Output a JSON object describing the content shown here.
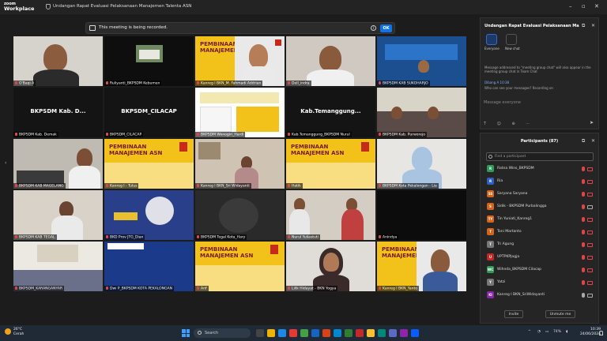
{
  "app": {
    "logo_line1": "zoom",
    "logo_line2": "Workplace",
    "window_title": "Undangan Rapat Evaluasi Pelaksanaan Manajemen Talenta ASN"
  },
  "recording": {
    "text": "This meeting is being recorded.",
    "info": "i",
    "ok_label": "OK"
  },
  "tiles": [
    {
      "label": "O'Baqi A"
    },
    {
      "label": "Ruliyanti_BKPSDM Kebumen"
    },
    {
      "label": "Kanreg I BKN_M. Fahmadi Addrian",
      "slide_title": "PEMBINAAN\nMANAJEMEN ASN"
    },
    {
      "label": "Dell_indra"
    },
    {
      "label": "BKPSDM KAB SUKOHARJO"
    },
    {
      "label": "BKPSDM Kab. Demak",
      "center": "BKPSDM Kab. D..."
    },
    {
      "label": "BKPSDM_CILACAP",
      "center": "BKPSDM_CILACAP"
    },
    {
      "label": "BKPSDM Wonogiri_Hardi"
    },
    {
      "label": "Kab.Temanggung_BKPSDM Nurul",
      "center": "Kab.Temanggung..."
    },
    {
      "label": "BKPSDM Kab. Purworejo"
    },
    {
      "label": "BKPSDM KAB MAGELANG"
    },
    {
      "label": "Kanreg I - Tulus",
      "slide_title": "PEMBINAAN\nMANAJEMEN ASN"
    },
    {
      "label": "Kanreg I BKN_Sri Widayanti"
    },
    {
      "label": "Hatik",
      "slide_title": "PEMBINAAN\nMANAJEMEN ASN"
    },
    {
      "label": "BKPSDM Kota Pekalongan - Lia"
    },
    {
      "label": "BKPSDM KAB TEGAL"
    },
    {
      "label": "BKD Prov JTG_Dian"
    },
    {
      "label": "BKPSDM Tegal Kota_Hary"
    },
    {
      "label": "Nurul Yuliastuti"
    },
    {
      "label": "Anindya"
    },
    {
      "label": "BKPSDM_KARANGANYAR"
    },
    {
      "label": "Dwi P_BKPSDM KOTA PEKALONGAN"
    },
    {
      "label": "Arif",
      "slide_title": "PEMBINAAN\nMANAJEMEN ASN"
    },
    {
      "label": "Lilik Hidayat - BKN Yogya"
    },
    {
      "label": "Kanreg I BKN_Yanto",
      "slide_title": "PEMBINAAN\nMANAJEMEN ASN"
    }
  ],
  "chat": {
    "title": "Undangan Rapat Evaluasi Pelaksanaan Manaje...",
    "tab_everyone": "Everyone",
    "tab_new_chat": "New chat",
    "msg1": "Message addressed to \"meeting group chat\" will also appear in the meeting group chat in Team Chat",
    "msg2_author": "Dibang A  10:38",
    "msg2_text": "Who can see your messages? Recording on",
    "input_placeholder": "Message everyone"
  },
  "participants": {
    "title": "Participants (87)",
    "search_placeholder": "Find a participant",
    "list": [
      {
        "initials": "R",
        "name": "Ratna Wins_BKPSDM",
        "color": "#2f9b56",
        "mic_on": false,
        "cam_on": false
      },
      {
        "initials": "R",
        "name": "Ria",
        "color": "#2d5fc4",
        "mic_on": false,
        "cam_on": false
      },
      {
        "initials": "SS",
        "name": "Saryana Saryana",
        "color": "#d4651c",
        "mic_on": false,
        "cam_on": false
      },
      {
        "initials": "S",
        "name": "Sidik - BKPSDM Purbalingga",
        "color": "#d4651c",
        "mic_on": false,
        "cam_on": true
      },
      {
        "initials": "TY",
        "name": "Tin Yuniati_Kanreg1",
        "color": "#d4651c",
        "mic_on": false,
        "cam_on": false
      },
      {
        "initials": "T",
        "name": "Toni Martanto",
        "color": "#d4651c",
        "mic_on": false,
        "cam_on": false
      },
      {
        "initials": "T",
        "name": "Tri Agung",
        "color": "#777777",
        "mic_on": false,
        "cam_on": false
      },
      {
        "initials": "U",
        "name": "UPTPKPJogja",
        "color": "#c62828",
        "mic_on": false,
        "cam_on": false
      },
      {
        "initials": "WC",
        "name": "Wihnda_BKPSDM Cilacap",
        "color": "#2f9b56",
        "mic_on": false,
        "cam_on": false
      },
      {
        "initials": "Y",
        "name": "Yatzi",
        "color": "#777777",
        "mic_on": false,
        "cam_on": false
      },
      {
        "initials": "KI",
        "name": "Kanreg I BKN_SriWidayanti",
        "color": "#8e24aa",
        "mic_on": true,
        "cam_on": true
      }
    ],
    "invite_label": "Invite",
    "unmute_label": "Unmute me"
  },
  "taskbar": {
    "temp": "26°C",
    "weather": "Cerah",
    "search_label": "Search",
    "time": "10:39",
    "date": "24/06/2024",
    "battery": "74%"
  }
}
